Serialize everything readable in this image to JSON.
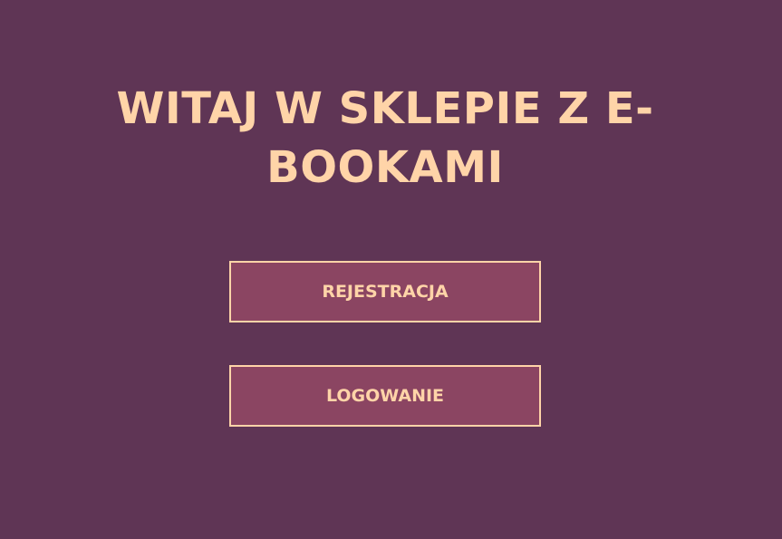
{
  "page": {
    "title": "WITAJ W SKLEPIE Z E-\nBOOKAMI",
    "background_color": "#5f3555",
    "accent_color": "#ffd4a8",
    "button_color": "#8b4562"
  },
  "actions": {
    "register_label": "REJESTRACJA",
    "login_label": "LOGOWANIE"
  }
}
